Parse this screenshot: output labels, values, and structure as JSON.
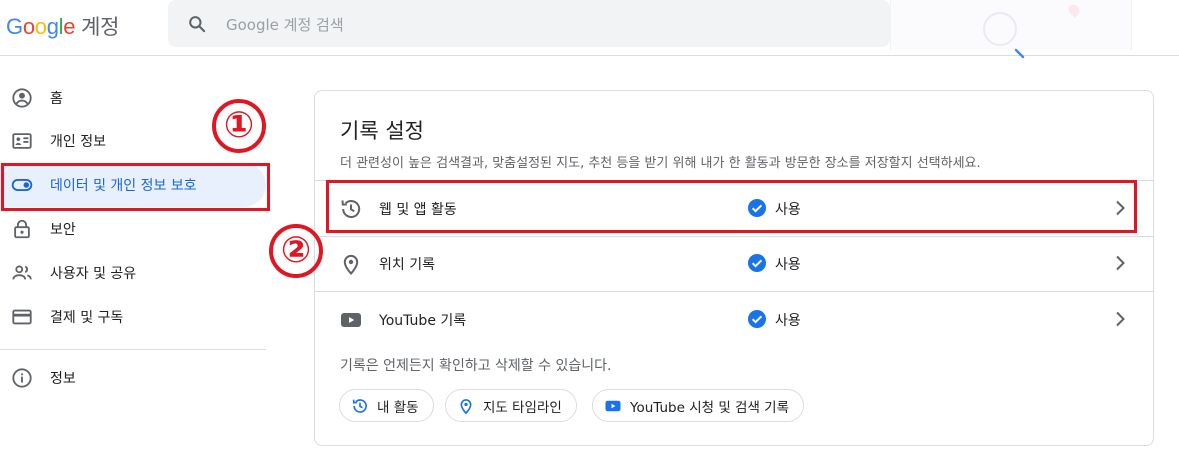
{
  "header": {
    "logo_letters": [
      "G",
      "o",
      "o",
      "g",
      "l",
      "e"
    ],
    "logo_colors": [
      "#4285F4",
      "#EA4335",
      "#FBBC05",
      "#4285F4",
      "#34A853",
      "#EA4335"
    ],
    "app_name": "계정",
    "search_placeholder": "Google 계정 검색",
    "search_icon": "search-icon"
  },
  "sidebar": {
    "items": [
      {
        "label": "홈",
        "icon": "account-circle-icon",
        "active": false
      },
      {
        "label": "개인 정보",
        "icon": "id-card-icon",
        "active": false
      },
      {
        "label": "데이터 및 개인 정보 보호",
        "icon": "toggle-icon",
        "active": true
      },
      {
        "label": "보안",
        "icon": "lock-icon",
        "active": false
      },
      {
        "label": "사용자 및 공유",
        "icon": "people-icon",
        "active": false
      },
      {
        "label": "결제 및 구독",
        "icon": "credit-card-icon",
        "active": false
      },
      {
        "label": "정보",
        "icon": "info-icon",
        "active": false
      }
    ]
  },
  "annotations": {
    "marker_1": "①",
    "marker_2": "②",
    "color": "#E01722"
  },
  "card": {
    "title": "기록 설정",
    "description": "더 관련성이 높은 검색결과, 맞춤설정된 지도, 추천 등을 받기 위해 내가 한 활동과 방문한 장소를 저장할지 선택하세요.",
    "rows": [
      {
        "label": "웹 및 앱 활동",
        "icon": "history-icon",
        "status": "사용"
      },
      {
        "label": "위치 기록",
        "icon": "location-pin-icon",
        "status": "사용"
      },
      {
        "label": "YouTube 기록",
        "icon": "youtube-icon",
        "status": "사용"
      }
    ],
    "footer_note": "기록은 언제든지 확인하고 삭제할 수 있습니다.",
    "chips": [
      {
        "label": "내 활동",
        "icon": "history-icon"
      },
      {
        "label": "지도 타임라인",
        "icon": "location-pin-icon"
      },
      {
        "label": "YouTube 시청 및 검색 기록",
        "icon": "youtube-icon"
      }
    ]
  },
  "colors": {
    "accent": "#1A73E8",
    "active_bg": "#E8F0FE",
    "text": "#202124",
    "secondary_text": "#5F6368",
    "divider": "#DADCE0"
  }
}
